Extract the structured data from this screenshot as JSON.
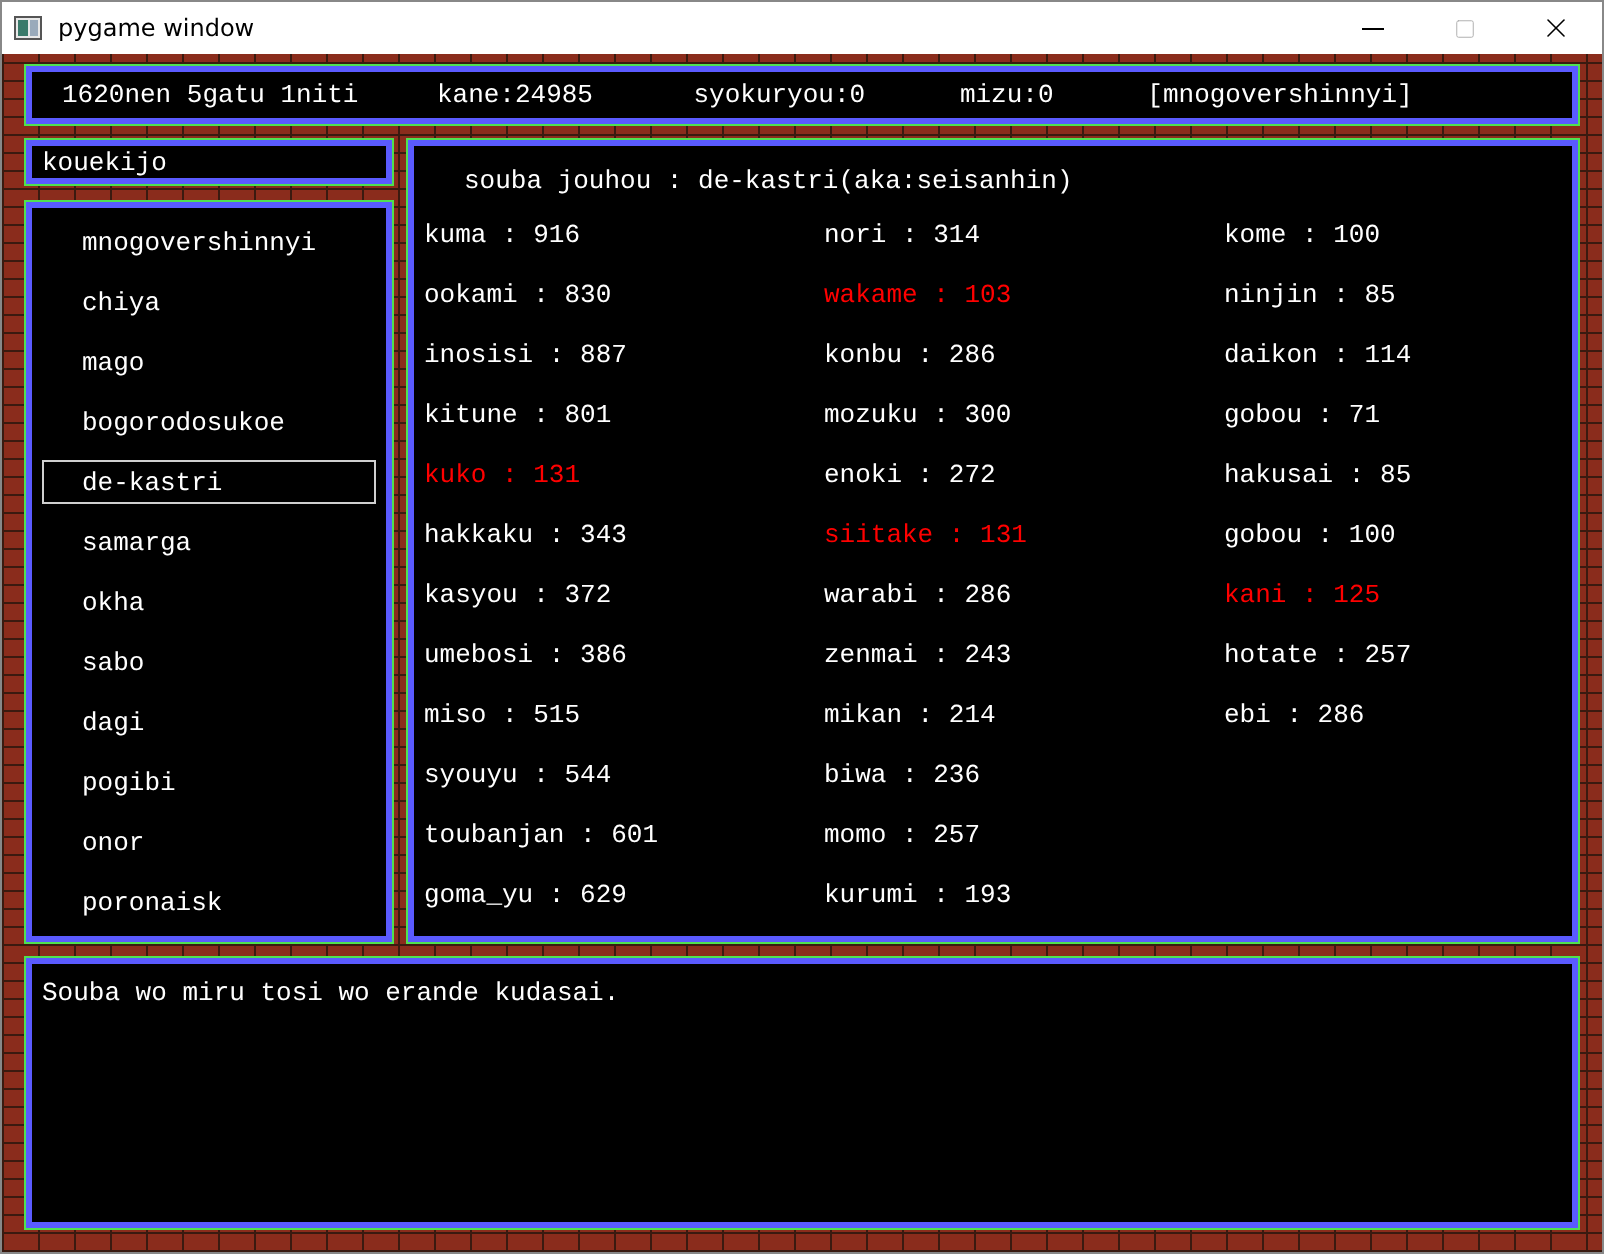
{
  "window": {
    "title": "pygame window"
  },
  "status_bar": [
    "1620nen 5gatu 1niti",
    "kane:24985",
    "syokuryou:0",
    "mizu:0",
    "[mnogovershinnyi]"
  ],
  "place": "kouekijo",
  "cities": [
    {
      "name": "mnogovershinnyi",
      "selected": false
    },
    {
      "name": "chiya",
      "selected": false
    },
    {
      "name": "mago",
      "selected": false
    },
    {
      "name": "bogorodosukoe",
      "selected": false
    },
    {
      "name": "de-kastri",
      "selected": true
    },
    {
      "name": "samarga",
      "selected": false
    },
    {
      "name": "okha",
      "selected": false
    },
    {
      "name": "sabo",
      "selected": false
    },
    {
      "name": "dagi",
      "selected": false
    },
    {
      "name": "pogibi",
      "selected": false
    },
    {
      "name": "onor",
      "selected": false
    },
    {
      "name": "poronaisk",
      "selected": false
    }
  ],
  "market": {
    "title": "souba jouhou : de-kastri(aka:seisanhin)",
    "columns": [
      [
        {
          "text": "kuma : 916",
          "color": "#ffffff"
        },
        {
          "text": "ookami : 830",
          "color": "#ffffff"
        },
        {
          "text": "inosisi : 887",
          "color": "#ffffff"
        },
        {
          "text": "kitune : 801",
          "color": "#ffffff"
        },
        {
          "text": "kuko : 131",
          "color": "#ff0000"
        },
        {
          "text": "hakkaku : 343",
          "color": "#ffffff"
        },
        {
          "text": "kasyou : 372",
          "color": "#ffffff"
        },
        {
          "text": "umebosi : 386",
          "color": "#ffffff"
        },
        {
          "text": "miso : 515",
          "color": "#ffffff"
        },
        {
          "text": "syouyu : 544",
          "color": "#ffffff"
        },
        {
          "text": "toubanjan : 601",
          "color": "#ffffff"
        },
        {
          "text": "goma_yu : 629",
          "color": "#ffffff"
        }
      ],
      [
        {
          "text": "nori : 314",
          "color": "#ffffff"
        },
        {
          "text": "wakame : 103",
          "color": "#ff0000"
        },
        {
          "text": "konbu : 286",
          "color": "#ffffff"
        },
        {
          "text": "mozuku : 300",
          "color": "#ffffff"
        },
        {
          "text": "enoki : 272",
          "color": "#ffffff"
        },
        {
          "text": "siitake : 131",
          "color": "#ff0000"
        },
        {
          "text": "warabi : 286",
          "color": "#ffffff"
        },
        {
          "text": "zenmai : 243",
          "color": "#ffffff"
        },
        {
          "text": "mikan : 214",
          "color": "#ffffff"
        },
        {
          "text": "biwa : 236",
          "color": "#ffffff"
        },
        {
          "text": "momo : 257",
          "color": "#ffffff"
        },
        {
          "text": "kurumi : 193",
          "color": "#ffffff"
        }
      ],
      [
        {
          "text": "kome : 100",
          "color": "#ffffff"
        },
        {
          "text": "ninjin : 85",
          "color": "#ffffff"
        },
        {
          "text": "daikon : 114",
          "color": "#ffffff"
        },
        {
          "text": "gobou : 71",
          "color": "#ffffff"
        },
        {
          "text": "hakusai : 85",
          "color": "#ffffff"
        },
        {
          "text": "gobou : 100",
          "color": "#ffffff"
        },
        {
          "text": "kani : 125",
          "color": "#ff0000"
        },
        {
          "text": "hotate : 257",
          "color": "#ffffff"
        },
        {
          "text": "ebi : 286",
          "color": "#ffffff"
        }
      ]
    ]
  },
  "message": "Souba wo miru tosi wo erande kudasai."
}
